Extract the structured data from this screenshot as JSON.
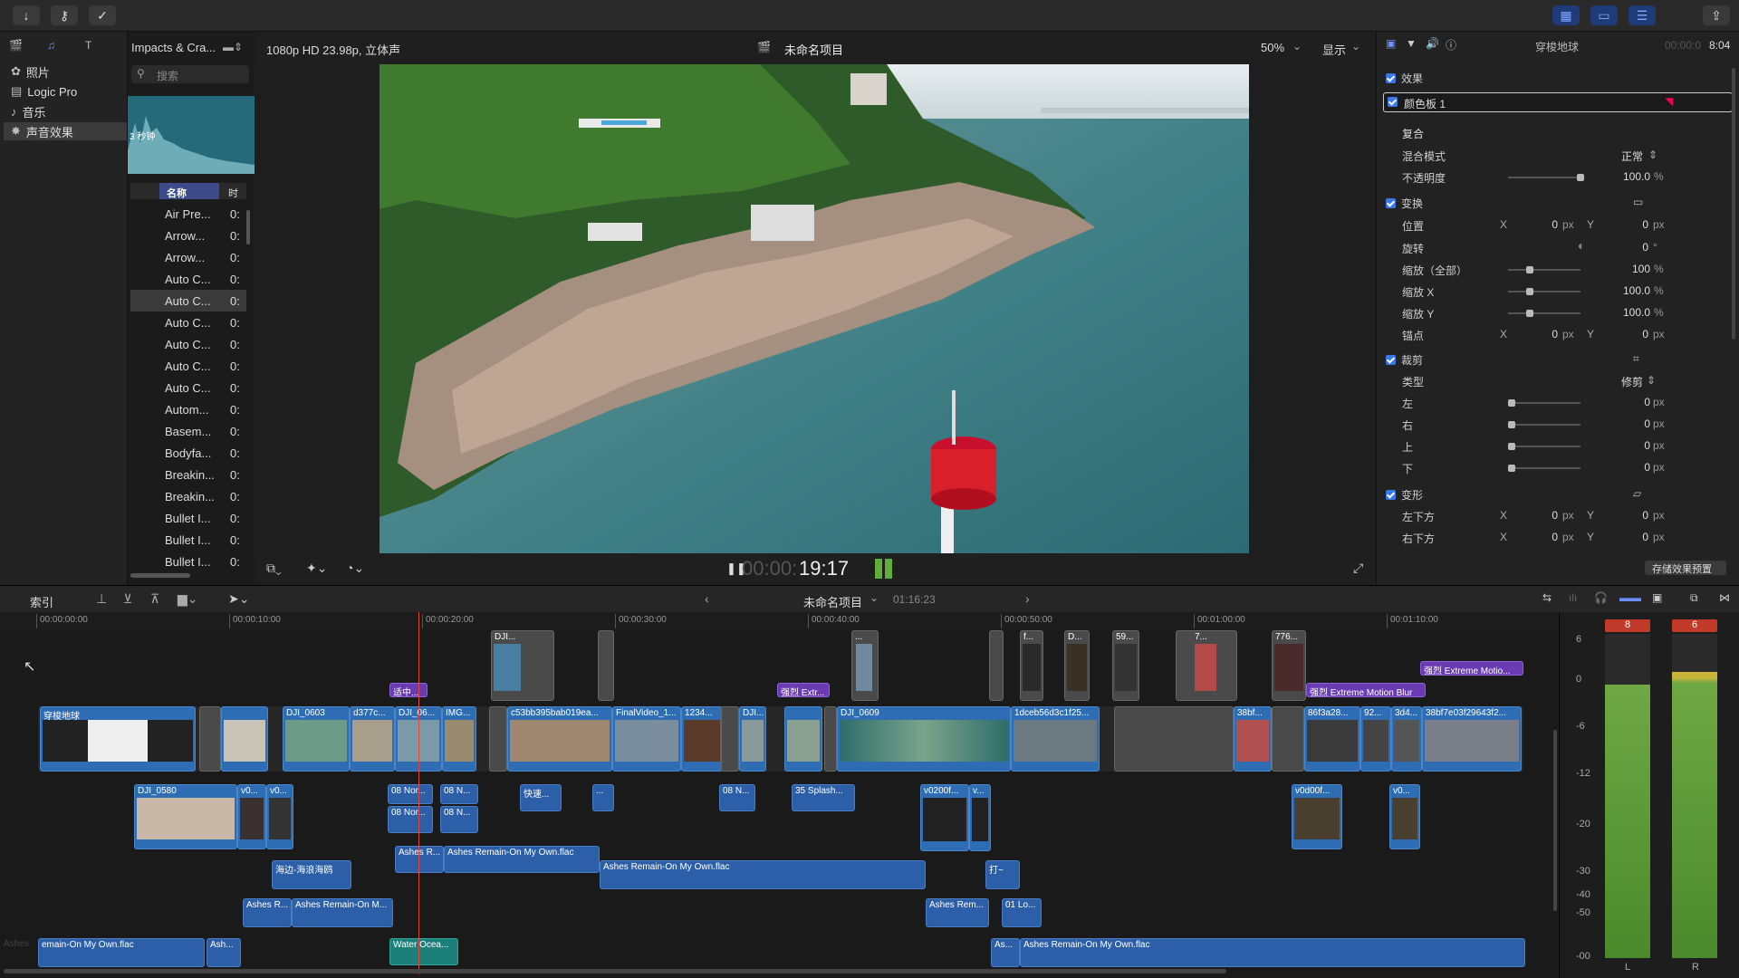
{
  "library": {
    "items": [
      {
        "label": "照片",
        "icon": "photos-icon"
      },
      {
        "label": "Logic Pro",
        "icon": "logic-pro-icon"
      },
      {
        "label": "音乐",
        "icon": "music-icon"
      },
      {
        "label": "声音效果",
        "icon": "sound-effects-icon"
      }
    ]
  },
  "browser": {
    "title": "Impacts & Cra...",
    "search_placeholder": "搜索",
    "preview_duration": "3 秒钟",
    "col_name": "名称",
    "col_time": "时",
    "rows": [
      {
        "name": "Air Pre...",
        "time": "0:"
      },
      {
        "name": "Arrow...",
        "time": "0:"
      },
      {
        "name": "Arrow...",
        "time": "0:"
      },
      {
        "name": "Auto C...",
        "time": "0:"
      },
      {
        "name": "Auto C...",
        "time": "0:"
      },
      {
        "name": "Auto C...",
        "time": "0:"
      },
      {
        "name": "Auto C...",
        "time": "0:"
      },
      {
        "name": "Auto C...",
        "time": "0:"
      },
      {
        "name": "Auto C...",
        "time": "0:"
      },
      {
        "name": "Autom...",
        "time": "0:"
      },
      {
        "name": "Basem...",
        "time": "0:"
      },
      {
        "name": "Bodyfa...",
        "time": "0:"
      },
      {
        "name": "Breakin...",
        "time": "0:"
      },
      {
        "name": "Breakin...",
        "time": "0:"
      },
      {
        "name": "Bullet I...",
        "time": "0:"
      },
      {
        "name": "Bullet I...",
        "time": "0:"
      },
      {
        "name": "Bullet I...",
        "time": "0:"
      }
    ],
    "selected_row": 4
  },
  "viewer": {
    "format": "1080p HD 23.98p, 立体声",
    "project_title": "未命名项目",
    "zoom": "50%",
    "display_label": "显示",
    "timecode_dim": "00:00:",
    "timecode": "19:17"
  },
  "inspector": {
    "clip_name": "穿梭地球",
    "duration_dim": "00:00:0",
    "duration": "8:04",
    "effects_label": "效果",
    "effect_name": "颜色板 1",
    "composite_label": "复合",
    "blend_mode_label": "混合模式",
    "blend_mode_value": "正常",
    "opacity_label": "不透明度",
    "opacity_value": "100.0",
    "opacity_unit": "%",
    "transform_label": "变换",
    "position_label": "位置",
    "position_x": "0",
    "position_y": "0",
    "rotation_label": "旋转",
    "rotation_value": "0",
    "rotation_unit": "°",
    "scale_all_label": "缩放（全部）",
    "scale_all_value": "100",
    "scale_x_label": "缩放 X",
    "scale_x_value": "100.0",
    "scale_y_label": "缩放 Y",
    "scale_y_value": "100.0",
    "anchor_label": "锚点",
    "anchor_x": "0",
    "anchor_y": "0",
    "crop_label": "裁剪",
    "crop_type_label": "类型",
    "crop_type_value": "修剪",
    "crop_left_label": "左",
    "crop_right_label": "右",
    "crop_top_label": "上",
    "crop_bottom_label": "下",
    "crop_value": "0",
    "distort_label": "变形",
    "bottom_left_label": "左下方",
    "bottom_right_label": "右下方",
    "x_label": "X",
    "y_label": "Y",
    "px_unit": "px",
    "percent_unit": "%",
    "save_preset_label": "存储效果预置"
  },
  "timeline": {
    "index_label": "索引",
    "project_title": "未命名项目",
    "duration": "01:16:23",
    "ruler": [
      "00:00:00:00",
      "00:00:10:00",
      "00:00:20:00",
      "00:00:30:00",
      "00:00:40:00",
      "00:00:50:00",
      "00:01:00:00",
      "00:01:10:00"
    ],
    "clips": {
      "c1": "穿梭地球",
      "c2": "DJI_0603",
      "c3": "d377c...",
      "c4": "DJI_06...",
      "c5": "IMG...",
      "c6": "c53bb395bab019ea...",
      "c7": "FinalVideo_1...",
      "c8": "1234...",
      "c9": "DJI...",
      "c10": "DJI_0609",
      "c11": "1dceb56d3c1f25...",
      "c12": "38bf...",
      "c13": "86f3a28...",
      "c14": "92...",
      "c15": "3d4...",
      "c16": "38bf7e03f29643f2...",
      "up1": "DJI...",
      "up2": "...",
      "up3": "f...",
      "up4": "D...",
      "up5": "59...",
      "up6": "7...",
      "up7": "776...",
      "t1": "适中...",
      "t2": "强烈 Extr...",
      "t3": "强烈 Extreme Motion Blur",
      "t4": "强烈 Extreme Motio...",
      "b1": "DJI_0580",
      "b2": "v0...",
      "b3": "v0...",
      "b4": "08 Nor...",
      "b5": "08 N...",
      "b6": "08 Nor...",
      "b7": "08 N...",
      "b8": "快速...",
      "b9": "...",
      "b10": "08 N...",
      "b11": "35 Splash...",
      "b12": "v0200f...",
      "b13": "v...",
      "b14": "v0d00f...",
      "b15": "v0...",
      "a1": "Ashes R...",
      "a2": "Ashes Remain-On My Own.flac",
      "a3": "Ashes Remain-On My Own.flac",
      "a4": "海边-海浪海鸥",
      "a5": "打~",
      "a6": "Ashes R...",
      "a7": "Ashes Remain-On M...",
      "a8": "Ashes Rem...",
      "a9": "01 Lo...",
      "a10": "emain-On My Own.flac",
      "a11": "Ash...",
      "a12": "Water Ocea...",
      "a13": "As...",
      "a14": "Ashes Remain-On My Own.flac",
      "a0": "Ashes"
    }
  },
  "meters": {
    "left_peak": "8",
    "right_peak": "6",
    "scale": [
      "6",
      "0",
      "-6",
      "-12",
      "-20",
      "-30",
      "-40",
      "-50",
      "-00"
    ],
    "left_label": "L",
    "right_label": "R"
  },
  "colors": {
    "accent": "#3a78e8",
    "video_clip": "#2e6db3",
    "audio_clip": "#2c5fa8",
    "title_clip": "#6a3bb3",
    "playhead": "#e0463b",
    "meter_green": "#5a9a3a"
  }
}
